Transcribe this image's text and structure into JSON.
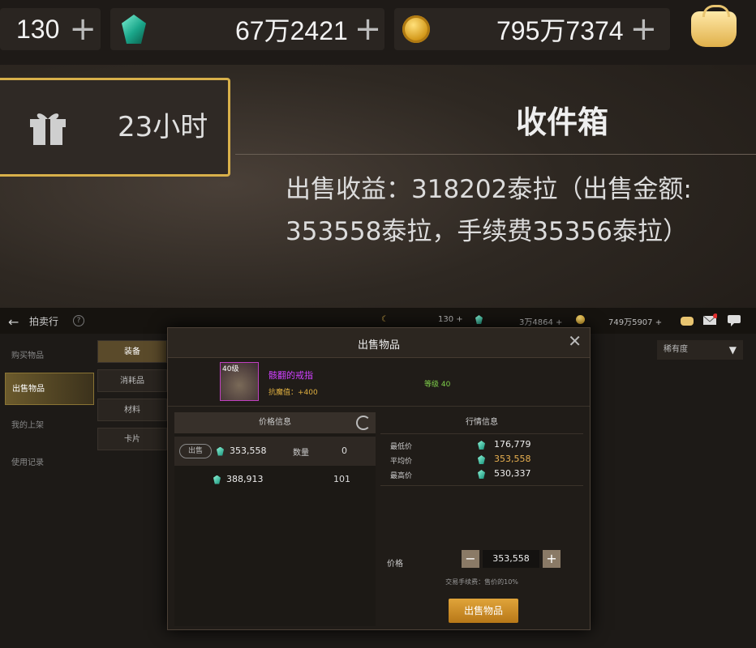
{
  "top": {
    "stamina": "130",
    "plus": "+",
    "gems": "67万2421",
    "gold": "795万7374",
    "gift_time": "23小时",
    "inbox_title": "收件箱",
    "income_line1": "出售收益：318202泰拉（出售金额:",
    "income_line2": "353558泰拉，手续费35356泰拉）"
  },
  "topbar": {
    "back": "←",
    "title": "拍卖行",
    "help": "?",
    "stamina": "130 +",
    "gems": "3万4864 +",
    "gold": "749万5907 +"
  },
  "sidebar": {
    "items": [
      "购买物品",
      "出售物品",
      "我的上架",
      "使用记录"
    ],
    "active": 1
  },
  "categories": [
    "装备",
    "消耗品",
    "材料",
    "卡片"
  ],
  "rarity_filter": "稀有度",
  "dialog": {
    "title": "出售物品",
    "close": "✕",
    "item": {
      "level": "40级",
      "name": "骸翻的戒指",
      "attr": "抗魔值：+400",
      "grade": "等级 40"
    },
    "price_info": {
      "header": "价格信息",
      "sell_tag": "出售",
      "row1_price": "353,558",
      "qty_label": "数量",
      "row1_qty": "0",
      "row2_price": "388,913",
      "row2_qty": "101"
    },
    "market": {
      "header": "行情信息",
      "rows": [
        {
          "label": "最低价",
          "value": "176,779"
        },
        {
          "label": "平均价",
          "value": "353,558"
        },
        {
          "label": "最高价",
          "value": "530,337"
        }
      ]
    },
    "price_label": "价格",
    "minus": "−",
    "plus": "+",
    "price_value": "353,558",
    "fee_text": "交易手续费：售价的10%",
    "sell_button": "出售物品"
  },
  "colors": {
    "gold_border": "#d8b04a",
    "item_name": "#d040ff",
    "avg_price": "#e8b050",
    "sell_button": "#d08c26"
  }
}
